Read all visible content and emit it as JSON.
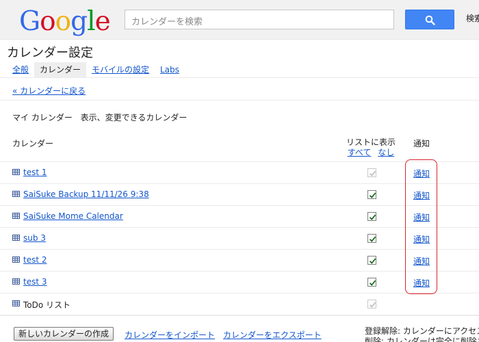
{
  "header": {
    "logo": {
      "letters": [
        "G",
        "o",
        "o",
        "g",
        "l",
        "e"
      ],
      "colors": [
        "#3369e8",
        "#d50f25",
        "#eeb211",
        "#3369e8",
        "#009925",
        "#d50f25"
      ]
    },
    "search_placeholder": "カレンダーを検索",
    "search_more_label": "検索"
  },
  "page": {
    "title": "カレンダー設定",
    "tabs": [
      {
        "label": "全般",
        "selected": false
      },
      {
        "label": "カレンダー",
        "selected": true
      },
      {
        "label": "モバイルの設定",
        "selected": false
      },
      {
        "label": "Labs",
        "selected": false
      }
    ],
    "back_link": "« カレンダーに戻る"
  },
  "section": {
    "heading": "マイ カレンダー",
    "description": "表示、変更できるカレンダー"
  },
  "columns": {
    "calendar": "カレンダー",
    "show_in_list": "リストに表示",
    "show_all": "すべて",
    "show_none": "なし",
    "notifications": "通知"
  },
  "calendars": [
    {
      "name": "test 1",
      "linked": true,
      "checked": true,
      "disabled": true,
      "notify": "通知"
    },
    {
      "name": "SaiSuke Backup 11/11/26 9:38",
      "linked": true,
      "checked": true,
      "disabled": false,
      "notify": "通知"
    },
    {
      "name": "SaiSuke Mome Calendar",
      "linked": true,
      "checked": true,
      "disabled": false,
      "notify": "通知"
    },
    {
      "name": "sub 3",
      "linked": true,
      "checked": true,
      "disabled": false,
      "notify": "通知"
    },
    {
      "name": "test 2",
      "linked": true,
      "checked": true,
      "disabled": false,
      "notify": "通知"
    },
    {
      "name": "test 3",
      "linked": true,
      "checked": true,
      "disabled": false,
      "notify": "通知"
    },
    {
      "name": "ToDo リスト",
      "linked": false,
      "checked": true,
      "disabled": true,
      "notify": ""
    }
  ],
  "footer": {
    "new_calendar_button": "新しいカレンダーの作成",
    "import_link": "カレンダーをインポート",
    "export_link": "カレンダーをエクスポート",
    "note_unsubscribe": "登録解除: カレンダーにアクセスできなくなります。",
    "note_delete": "削除: カレンダーは完全に削除されます。"
  },
  "colors": {
    "accent_link": "#1155cc",
    "search_button": "#4285f4",
    "highlight": "#d9232a"
  }
}
